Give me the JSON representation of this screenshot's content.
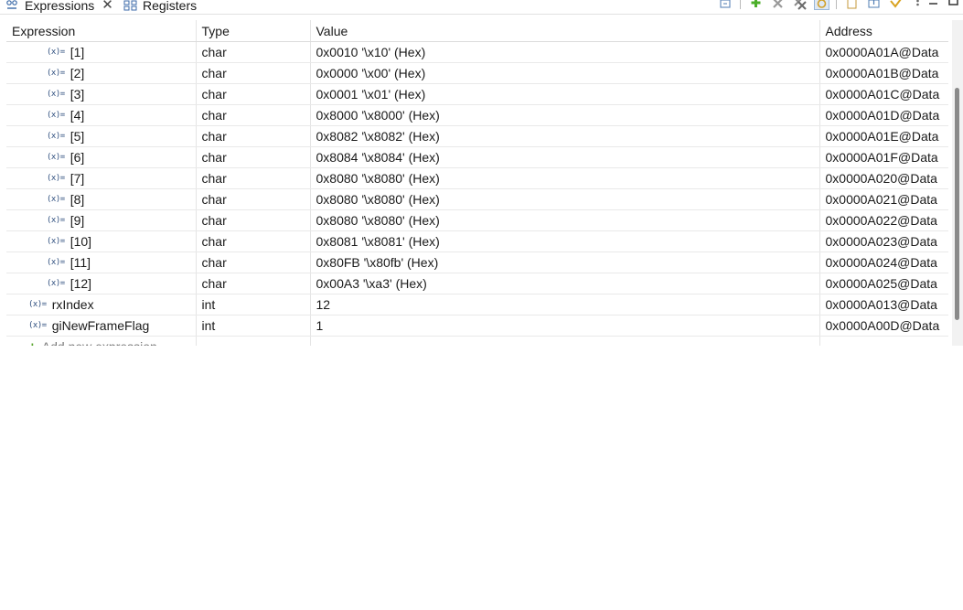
{
  "tabs": [
    {
      "label": "Expressions",
      "icon": "expressions-icon"
    },
    {
      "label": "Registers",
      "icon": "registers-icon"
    }
  ],
  "columns": [
    "Expression",
    "Type",
    "Value",
    "Address"
  ],
  "rows": [
    {
      "expression": "[1]",
      "type": "char",
      "value": "0x0010 '\\x10' (Hex)",
      "address": "0x0000A01A@Data"
    },
    {
      "expression": "[2]",
      "type": "char",
      "value": "0x0000 '\\x00' (Hex)",
      "address": "0x0000A01B@Data"
    },
    {
      "expression": "[3]",
      "type": "char",
      "value": "0x0001 '\\x01' (Hex)",
      "address": "0x0000A01C@Data"
    },
    {
      "expression": "[4]",
      "type": "char",
      "value": "0x8000 '\\x8000' (Hex)",
      "address": "0x0000A01D@Data"
    },
    {
      "expression": "[5]",
      "type": "char",
      "value": "0x8082 '\\x8082' (Hex)",
      "address": "0x0000A01E@Data"
    },
    {
      "expression": "[6]",
      "type": "char",
      "value": "0x8084 '\\x8084' (Hex)",
      "address": "0x0000A01F@Data"
    },
    {
      "expression": "[7]",
      "type": "char",
      "value": "0x8080 '\\x8080' (Hex)",
      "address": "0x0000A020@Data"
    },
    {
      "expression": "[8]",
      "type": "char",
      "value": "0x8080 '\\x8080' (Hex)",
      "address": "0x0000A021@Data"
    },
    {
      "expression": "[9]",
      "type": "char",
      "value": "0x8080 '\\x8080' (Hex)",
      "address": "0x0000A022@Data"
    },
    {
      "expression": "[10]",
      "type": "char",
      "value": "0x8081 '\\x8081' (Hex)",
      "address": "0x0000A023@Data"
    },
    {
      "expression": "[11]",
      "type": "char",
      "value": "0x80FB '\\x80fb' (Hex)",
      "address": "0x0000A024@Data"
    },
    {
      "expression": "[12]",
      "type": "char",
      "value": "0x00A3 '\\xa3' (Hex)",
      "address": "0x0000A025@Data"
    },
    {
      "expression": "rxIndex",
      "type": "int",
      "value": "12",
      "address": "0x0000A013@Data"
    },
    {
      "expression": "giNewFrameFlag",
      "type": "int",
      "value": "1",
      "address": "0x0000A00D@Data"
    }
  ],
  "add_expression_label": "Add new expression",
  "variable_icon_glyph": "(x)=",
  "close_glyph": "✕"
}
